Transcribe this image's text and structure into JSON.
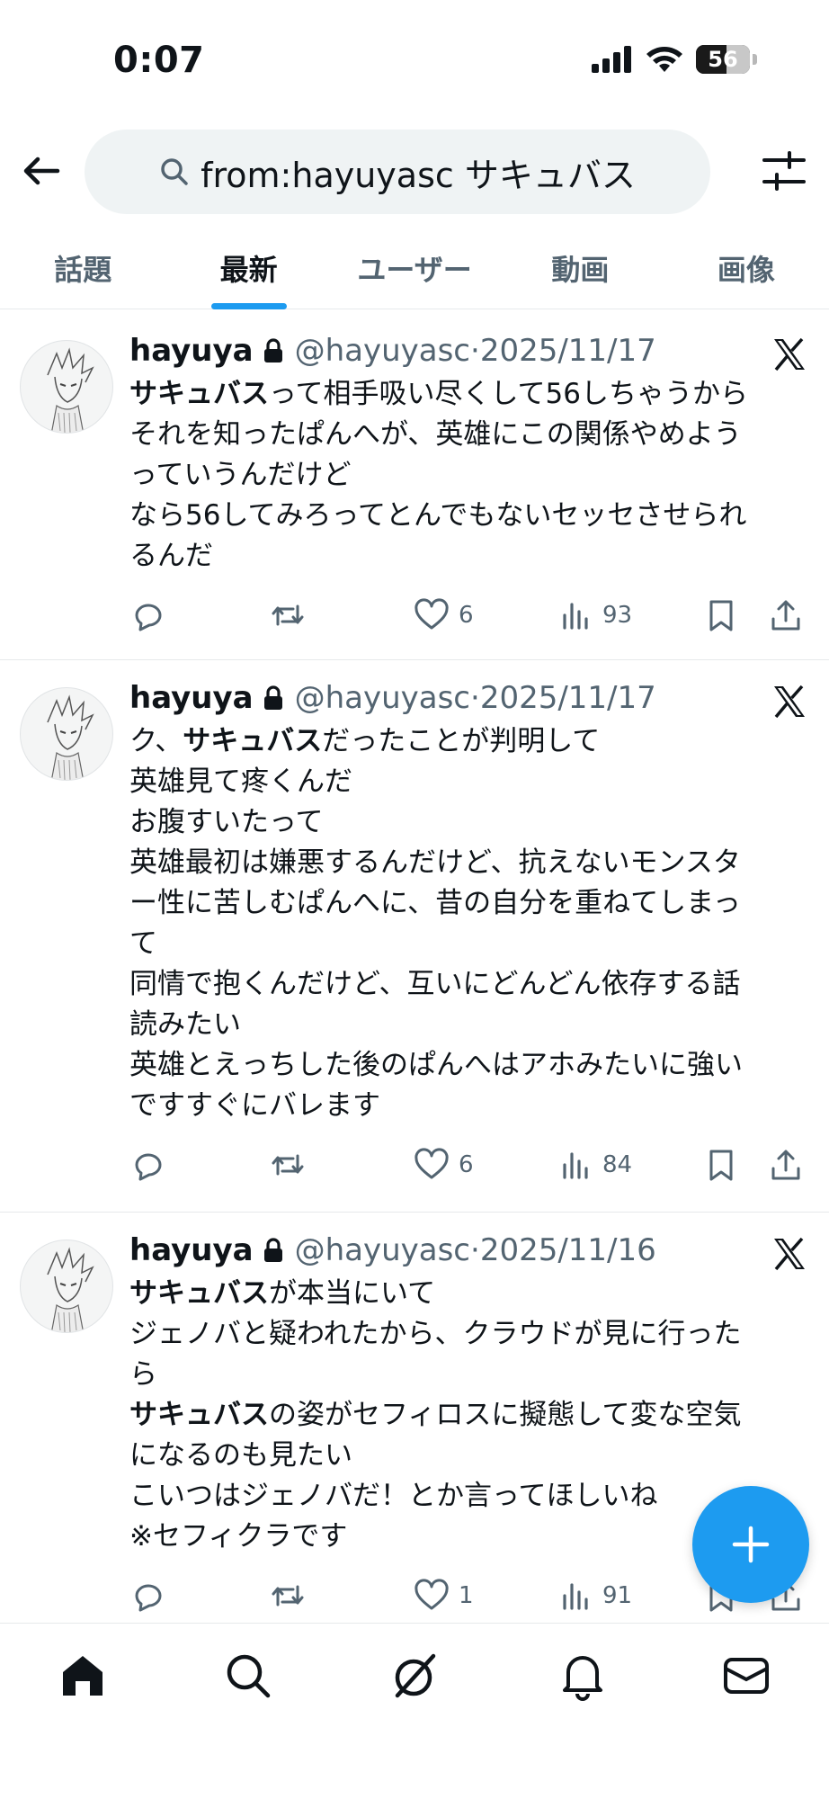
{
  "status_bar": {
    "time": "0:07",
    "battery": "56"
  },
  "search": {
    "query": "from:hayuyasc サキュバス"
  },
  "tabs": [
    {
      "label": "話題"
    },
    {
      "label": "最新"
    },
    {
      "label": "ユーザー"
    },
    {
      "label": "動画"
    },
    {
      "label": "画像"
    }
  ],
  "active_tab": "最新",
  "tweets": [
    {
      "name": "hayuya",
      "handle": "@hayuyasc",
      "date": "2025/11/17",
      "lines": [
        "サキュバスって相手吸い尽くして56しちゃうから",
        "それを知ったぱんへが、英雄にこの関係やめよう",
        "っていうんだけど",
        "なら56してみろってとんでもないセッセさせられ",
        "るんだ"
      ],
      "likes": "6",
      "views": "93"
    },
    {
      "name": "hayuya",
      "handle": "@hayuyasc",
      "date": "2025/11/17",
      "lines": [
        "ク、サキュバスだったことが判明して",
        "英雄見て疼くんだ",
        "お腹すいたって",
        "英雄最初は嫌悪するんだけど、抗えないモンスタ",
        "ー性に苦しむぱんへに、昔の自分を重ねてしまっ",
        "て",
        "同情で抱くんだけど、互いにどんどん依存する話",
        "読みたい",
        "英雄とえっちした後のぱんへはアホみたいに強い",
        "ですすぐにバレます"
      ],
      "likes": "6",
      "views": "84"
    },
    {
      "name": "hayuya",
      "handle": "@hayuyasc",
      "date": "2025/11/16",
      "lines": [
        "サキュバスが本当にいて",
        "ジェノバと疑われたから、クラウドが見に行った",
        "ら",
        "サキュバスの姿がセフィロスに擬態して変な空気",
        "になるのも見たい",
        "こいつはジェノバだ！とか言ってほしいね",
        "※セフィクラです"
      ],
      "likes": "1",
      "views": "91"
    }
  ],
  "highlight_term": "サキュバス",
  "colors": {
    "accent": "#1d9bf0",
    "text": "#0f1419",
    "secondary": "#536471"
  },
  "icons": {
    "header": [
      "back-arrow-icon",
      "search-icon",
      "filter-sliders-icon"
    ],
    "tweet_actions": [
      "reply-icon",
      "retweet-icon",
      "heart-icon",
      "views-chart-icon",
      "bookmark-icon",
      "share-icon"
    ],
    "bottom_nav": [
      "home-icon",
      "search-icon",
      "grok-icon",
      "notifications-bell-icon",
      "messages-envelope-icon"
    ],
    "fab": "plus-icon"
  }
}
